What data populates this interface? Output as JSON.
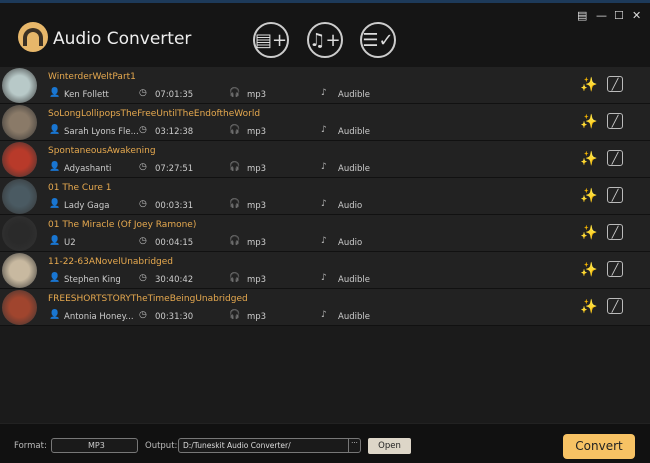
{
  "app": {
    "title": "Audio Converter"
  },
  "toolbar": [
    {
      "name": "add-files-button",
      "glyph": "▤+"
    },
    {
      "name": "add-audio-button",
      "glyph": "♫+"
    },
    {
      "name": "converted-list-button",
      "glyph": "☰✓"
    }
  ],
  "window": {
    "menu": "▤",
    "minimize": "—",
    "maximize": "☐",
    "close": "✕"
  },
  "items": [
    {
      "title": "WinterderWeltPart1",
      "author": "Ken Follett",
      "duration": "07:01:35",
      "format": "mp3",
      "source": "Audible",
      "thumb": "#b8c9c8"
    },
    {
      "title": "SoLongLollipopsTheFreeUntilTheEndoftheWorld",
      "author": "Sarah Lyons Fle...",
      "duration": "03:12:38",
      "format": "mp3",
      "source": "Audible",
      "thumb": "#8a7a68"
    },
    {
      "title": "SpontaneousAwakening",
      "author": "Adyashanti",
      "duration": "07:27:51",
      "format": "mp3",
      "source": "Audible",
      "thumb": "#b83a2a"
    },
    {
      "title": "01 The Cure 1",
      "author": "Lady Gaga",
      "duration": "00:03:31",
      "format": "mp3",
      "source": "Audio",
      "thumb": "#4a5a62"
    },
    {
      "title": "01 The Miracle (Of Joey Ramone)",
      "author": "U2",
      "duration": "00:04:15",
      "format": "mp3",
      "source": "Audio",
      "thumb": "#2a2a2a"
    },
    {
      "title": "11-22-63ANovelUnabridged",
      "author": "Stephen King",
      "duration": "30:40:42",
      "format": "mp3",
      "source": "Audible",
      "thumb": "#c8b9a0"
    },
    {
      "title": "FREESHORTSTORYTheTimeBeingUnabridged",
      "author": "Antonia Honey...",
      "duration": "00:31:30",
      "format": "mp3",
      "source": "Audible",
      "thumb": "#a0452e"
    }
  ],
  "footer": {
    "format_label": "Format:",
    "format_value": "MP3",
    "output_label": "Output:",
    "output_value": "D:/Tuneskit Audio Converter/",
    "browse": "···",
    "open": "Open",
    "convert": "Convert"
  },
  "colors": {
    "accent": "#f7c264",
    "title": "#e6a94f"
  }
}
